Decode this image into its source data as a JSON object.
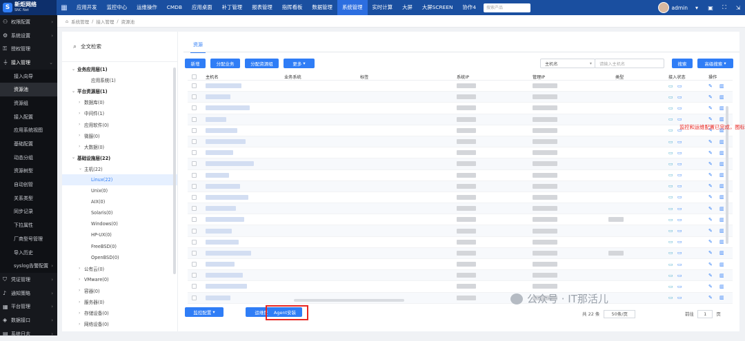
{
  "app": {
    "logo_name": "新炬网络",
    "logo_sub": "SNC Net",
    "top_nav": [
      "应用开发",
      "监控中心",
      "运维操作",
      "CMDB",
      "应用桌面",
      "补丁管理",
      "报表管理",
      "指挥看板",
      "数据管理",
      "系统管理",
      "实时计算",
      "大屏",
      "大屏SCREEN",
      "协作4"
    ],
    "active_nav": "系统管理",
    "search_placeholder": "搜索产品",
    "user": "admin"
  },
  "sidebar": [
    {
      "label": "权限配置",
      "icon": "user-icon",
      "arrow": true
    },
    {
      "label": "系统设置",
      "icon": "gear-icon",
      "arrow": true
    },
    {
      "label": "授权管理",
      "icon": "key-icon"
    },
    {
      "label": "接入管理",
      "icon": "plug-icon",
      "arrow": true,
      "open": true
    },
    {
      "label": "接入向导",
      "sub": true
    },
    {
      "label": "资源池",
      "sub": true,
      "active": true
    },
    {
      "label": "资源组",
      "sub": true
    },
    {
      "label": "接入配置",
      "sub": true
    },
    {
      "label": "应用系统视图",
      "sub": true
    },
    {
      "label": "基础配置",
      "sub": true
    },
    {
      "label": "动态分组",
      "sub": true
    },
    {
      "label": "资源树型",
      "sub": true
    },
    {
      "label": "自动创管",
      "sub": true
    },
    {
      "label": "关系类型",
      "sub": true
    },
    {
      "label": "同步记录",
      "sub": true
    },
    {
      "label": "下拉属性",
      "sub": true
    },
    {
      "label": "厂商型号管理",
      "sub": true
    },
    {
      "label": "导入历史",
      "sub": true
    },
    {
      "label": "syslog告警配置",
      "sub": true,
      "arrow": true
    },
    {
      "label": "凭证管理",
      "icon": "shield-icon",
      "arrow": true
    },
    {
      "label": "通知策略",
      "icon": "bell-icon",
      "arrow": true
    },
    {
      "label": "平台管理",
      "icon": "grid-icon",
      "arrow": true
    },
    {
      "label": "数据接口",
      "icon": "diamond-icon",
      "arrow": true
    },
    {
      "label": "系统日志",
      "icon": "doc-icon",
      "arrow": true
    }
  ],
  "breadcrumb": [
    "系统管理",
    "接入管理",
    "资源池"
  ],
  "tree": {
    "title": "全文检索",
    "nodes": [
      {
        "label": "业务应用层(1)",
        "level": 0,
        "toggle": "v",
        "bold": true
      },
      {
        "label": "应用系统(1)",
        "level": 2
      },
      {
        "label": "平台资源层(1)",
        "level": 0,
        "toggle": "v",
        "bold": true
      },
      {
        "label": "数据库(0)",
        "level": 1,
        "toggle": ">"
      },
      {
        "label": "中间件(1)",
        "level": 1,
        "toggle": ">"
      },
      {
        "label": "应用软件(0)",
        "level": 1,
        "toggle": ">"
      },
      {
        "label": "微服(0)",
        "level": 1,
        "toggle": ">"
      },
      {
        "label": "大数据(0)",
        "level": 1,
        "toggle": ">"
      },
      {
        "label": "基础设施层(22)",
        "level": 0,
        "toggle": "v",
        "bold": true
      },
      {
        "label": "主机(22)",
        "level": 1,
        "toggle": "v"
      },
      {
        "label": "Linux(22)",
        "level": 2,
        "selected": true
      },
      {
        "label": "Unix(0)",
        "level": 2
      },
      {
        "label": "AIX(0)",
        "level": 2
      },
      {
        "label": "Solaris(0)",
        "level": 2
      },
      {
        "label": "Windows(0)",
        "level": 2
      },
      {
        "label": "HP-UX(0)",
        "level": 2
      },
      {
        "label": "FreeBSD(0)",
        "level": 2
      },
      {
        "label": "OpenBSD(0)",
        "level": 2
      },
      {
        "label": "公有云(0)",
        "level": 1,
        "toggle": ">"
      },
      {
        "label": "VMware(0)",
        "level": 1,
        "toggle": ">"
      },
      {
        "label": "容器(0)",
        "level": 1,
        "toggle": ">"
      },
      {
        "label": "服务器(0)",
        "level": 1,
        "toggle": ">"
      },
      {
        "label": "存储设备(0)",
        "level": 1,
        "toggle": ">"
      },
      {
        "label": "网络设备(0)",
        "level": 1,
        "toggle": ">"
      }
    ]
  },
  "tab": "资源",
  "toolbar": {
    "new": "新增",
    "assign_business": "分配业务",
    "assign_group": "分配资源组",
    "more": "更多",
    "field_select": "主机名",
    "search_placeholder": "请输入主机名",
    "search": "搜索",
    "advanced": "高级搜索"
  },
  "table": {
    "headers": [
      "主机名",
      "业务系统",
      "标签",
      "系统IP",
      "管理IP",
      "类型",
      "接入状态",
      "操作"
    ],
    "row_count": 20
  },
  "annotation": "监控和运维配置已完成，图标点亮",
  "bottom": {
    "monitor_config": "监控配置",
    "ops_config": "运维配置",
    "agent_install": "Agent安装",
    "total": "共 22 条",
    "per_page": "50条/页",
    "goto": "前往",
    "page": "1",
    "page_unit": "页"
  },
  "watermark": "公众号 · IT那活儿",
  "colors": {
    "topbar": "#1a4fa0",
    "accent": "#2f7df6",
    "sidebar": "#16181d",
    "alert": "#e8241f"
  }
}
